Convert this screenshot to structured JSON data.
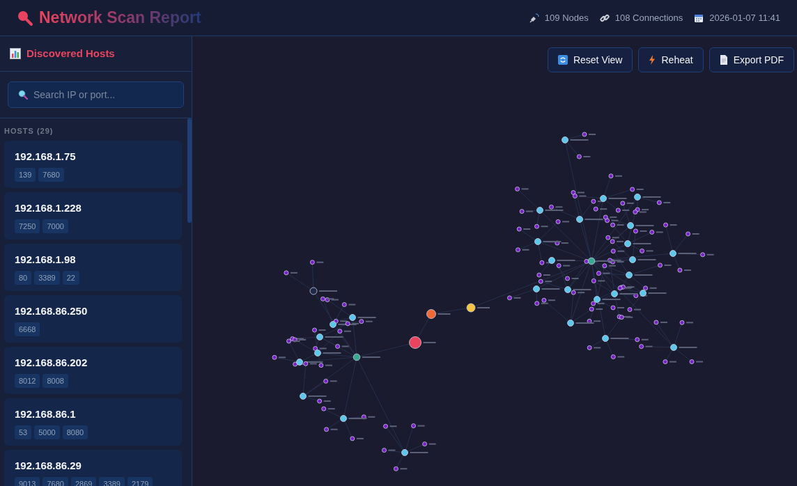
{
  "header": {
    "title": "Network Scan Report",
    "stats": [
      {
        "kind": "nodes",
        "text": "109 Nodes"
      },
      {
        "kind": "connections",
        "text": "108 Connections"
      },
      {
        "kind": "date",
        "text": "2026-01-07 11:41"
      }
    ]
  },
  "sidebar": {
    "title": "Discovered Hosts",
    "search": {
      "placeholder": "Search IP or port..."
    },
    "hosts_label": "HOSTS (29)",
    "hosts": [
      {
        "ip": "192.168.1.75",
        "ports": [
          "139",
          "7680"
        ]
      },
      {
        "ip": "192.168.1.228",
        "ports": [
          "7250",
          "7000"
        ]
      },
      {
        "ip": "192.168.1.98",
        "ports": [
          "80",
          "3389",
          "22"
        ]
      },
      {
        "ip": "192.168.86.250",
        "ports": [
          "6668"
        ]
      },
      {
        "ip": "192.168.86.202",
        "ports": [
          "8012",
          "8008"
        ]
      },
      {
        "ip": "192.168.86.1",
        "ports": [
          "53",
          "5000",
          "8080"
        ]
      },
      {
        "ip": "192.168.86.29",
        "ports": [
          "9013",
          "7680",
          "2869",
          "3389",
          "2179"
        ]
      }
    ]
  },
  "toolbar": [
    {
      "kind": "reset",
      "label": "Reset View"
    },
    {
      "kind": "reheat",
      "label": "Reheat"
    },
    {
      "kind": "export",
      "label": "Export PDF"
    }
  ]
}
